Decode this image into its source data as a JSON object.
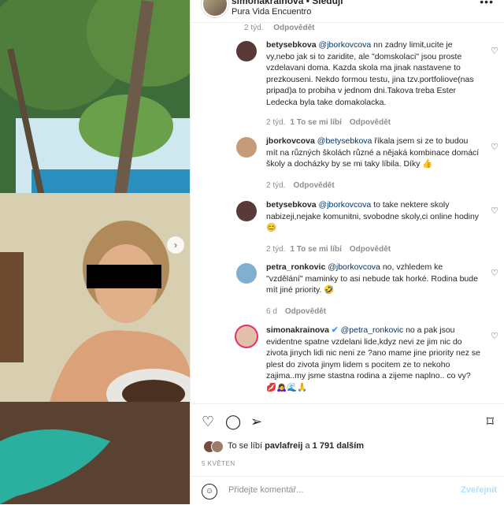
{
  "header": {
    "username": "simonakrainova",
    "follow_sep": "• Sledují",
    "location": "Pura Vida Encuentro",
    "more": "•••"
  },
  "top_meta": {
    "time": "2 týd.",
    "reply": "Odpovědět"
  },
  "comments": [
    {
      "username": "betysebkova",
      "mention": "@jborkovcova",
      "text": "nn zadny limit,ucite je vy,nebo jak si to zaridite, ale \"domskolaci\" jsou proste vzdelavani doma. Kazda skola ma jinak nastavene to prezkouseni. Nekdo formou testu, jina tzv.portfoliove(nas pripad)a to probiha v jednom dni.Takova treba Ester Ledecka byla take domakolacka.",
      "time": "2 týd.",
      "likes": "1 To se mi líbí",
      "reply": "Odpovědět"
    },
    {
      "username": "jborkovcova",
      "mention": "@betysebkova",
      "text": "říkala jsem si ze to budou mít na různých školách různé a nějaká kombinace domácí školy a docházky by se mi taky líbila. Díky 👍",
      "time": "2 týd.",
      "likes": "",
      "reply": "Odpovědět"
    },
    {
      "username": "betysebkova",
      "mention": "@jborkovcova",
      "text": "to take nektere skoly nabizeji,nejake komunitni, svobodne skoly,ci online hodiny😊",
      "time": "2 týd.",
      "likes": "1 To se mi líbí",
      "reply": "Odpovědět"
    },
    {
      "username": "petra_ronkovic",
      "mention": "@jborkovcova",
      "text": "no, vzhledem ke \"vzdělání\" maminky to asi nebude tak horké. Rodina bude mít jiné priority. 🤣",
      "time": "6 d",
      "likes": "",
      "reply": "Odpovědět"
    },
    {
      "username": "simonakrainova",
      "verified": "✔",
      "mention": "@petra_ronkovic",
      "text": "no a pak jsou evidentne spatne vzdelani lide,kdyz nevi ze jim nic do zivota jinych lidi nic neni ze ?ano mame jine priority nez se plest do zivota jinym lidem s pocitem ze to nekoho zajima..my jsme stastna rodina a zijeme naplno.. co vy?💋🙇‍♀️🌊🙏",
      "time": "",
      "likes": "",
      "reply": ""
    }
  ],
  "actions": {
    "likes_prefix": "To se líbí",
    "likes_user": "pavlafreij",
    "likes_suffix": "a",
    "likes_count": "1 791 dalším",
    "date": "5 KVĚTEN"
  },
  "add_comment": {
    "placeholder": "Přidejte komentář...",
    "post": "Zveřejnit"
  },
  "colors": {
    "link": "#00376b",
    "muted": "#8e8e8e",
    "post_disabled": "#b2dffc"
  }
}
